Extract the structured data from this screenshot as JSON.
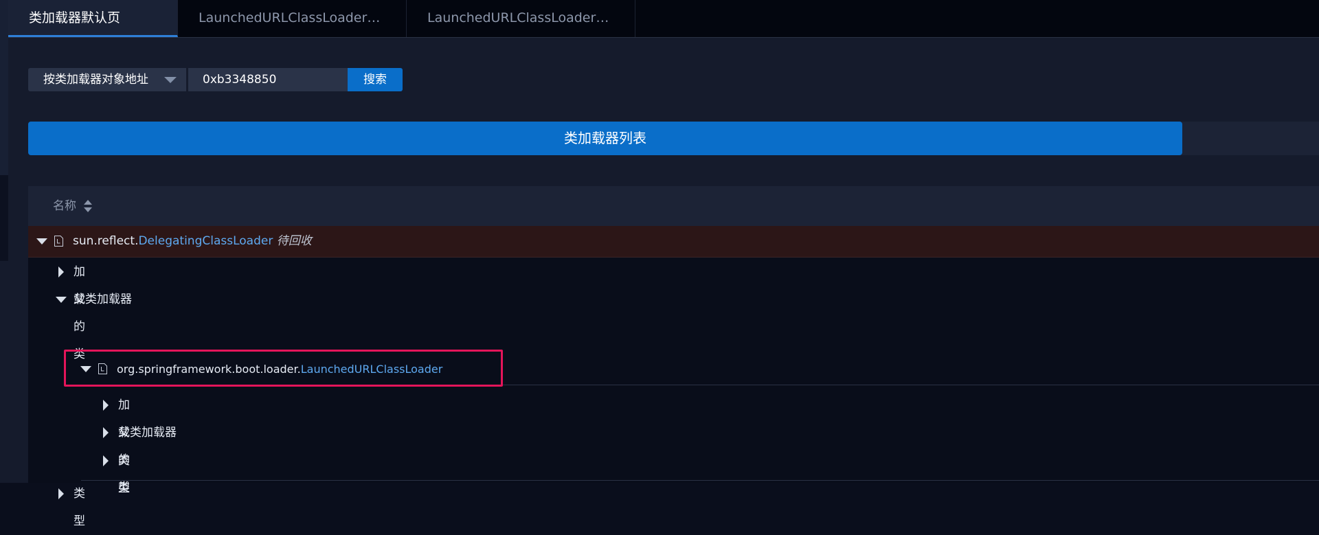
{
  "tabs": [
    {
      "label": "类加载器默认页",
      "active": true
    },
    {
      "label": "LaunchedURLClassLoader@...",
      "active": false
    },
    {
      "label": "LaunchedURLClassLoader@...",
      "active": false
    }
  ],
  "search": {
    "mode_selected": "按类加载器对象地址",
    "value": "0xb3348850",
    "button_label": "搜索"
  },
  "banner": {
    "title": "类加载器列表"
  },
  "table": {
    "column_name": "名称",
    "root": {
      "package": "sun.reflect.",
      "class_name": "DelegatingClassLoader",
      "tag": "待回收",
      "children": {
        "loaded_classes": "加载的类",
        "parent_loader": "父类加载器",
        "type": "类型"
      },
      "parent": {
        "package": "org.springframework.boot.loader.",
        "class_name": "LaunchedURLClassLoader",
        "children": {
          "loaded_classes": "加载的类",
          "parent_loader": "父类加载器",
          "type": "类型"
        }
      }
    }
  },
  "colors": {
    "accent": "#0a6ec9",
    "highlight_border": "#e4155a",
    "pending_row_bg": "#2c1617",
    "class_link": "#5ea9f0"
  },
  "icons": {
    "expanded": "caret-down-icon",
    "collapsed": "caret-right-icon",
    "class_loader": "file-icon",
    "sort": "sort-icon"
  }
}
